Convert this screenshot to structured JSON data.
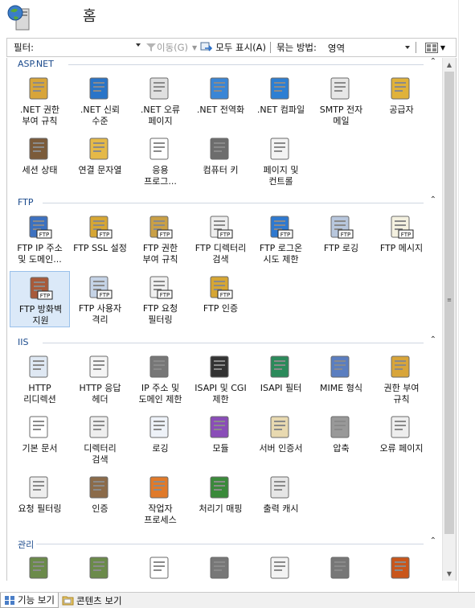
{
  "header": {
    "title": "홈"
  },
  "toolbar": {
    "filter_label": "필터:",
    "filter_value": "",
    "go_label": "이동(G)",
    "show_all_label": "모두 표시(A)",
    "group_label": "묶는 방법:",
    "group_value": "영역"
  },
  "sections": [
    {
      "title": "ASP.NET",
      "items": [
        {
          "label": ".NET 권한\n부여 규칙",
          "icon": "net-authorization-icon"
        },
        {
          "label": ".NET 신뢰\n수준",
          "icon": "net-trust-icon"
        },
        {
          "label": ".NET 오류\n페이지",
          "icon": "net-error-pages-icon"
        },
        {
          "label": ".NET 전역화",
          "icon": "net-globalization-icon"
        },
        {
          "label": ".NET 컴파일",
          "icon": "net-compilation-icon"
        },
        {
          "label": "SMTP 전자\n메일",
          "icon": "smtp-email-icon"
        },
        {
          "label": "공급자",
          "icon": "providers-icon"
        },
        {
          "label": "세션 상태",
          "icon": "session-state-icon"
        },
        {
          "label": "연결 문자열",
          "icon": "connection-strings-icon"
        },
        {
          "label": "응용\n프로그...",
          "icon": "app-settings-icon"
        },
        {
          "label": "컴퓨터 키",
          "icon": "machine-key-icon"
        },
        {
          "label": "페이지 및\n컨트롤",
          "icon": "pages-controls-icon"
        }
      ]
    },
    {
      "title": "FTP",
      "items": [
        {
          "label": "FTP IP 주소\n및 도메인...",
          "icon": "ftp-ip-domain-icon"
        },
        {
          "label": "FTP SSL 설정",
          "icon": "ftp-ssl-icon"
        },
        {
          "label": "FTP 권한\n부여 규칙",
          "icon": "ftp-authorization-icon"
        },
        {
          "label": "FTP 디렉터리\n검색",
          "icon": "ftp-directory-browsing-icon"
        },
        {
          "label": "FTP 로그온\n시도 제한",
          "icon": "ftp-logon-attempts-icon"
        },
        {
          "label": "FTP 로깅",
          "icon": "ftp-logging-icon"
        },
        {
          "label": "FTP 메시지",
          "icon": "ftp-messages-icon"
        },
        {
          "label": "FTP 방화벽\n지원",
          "icon": "ftp-firewall-icon"
        },
        {
          "label": "FTP 사용자\n격리",
          "icon": "ftp-user-isolation-icon"
        },
        {
          "label": "FTP 요청\n필터링",
          "icon": "ftp-request-filtering-icon"
        },
        {
          "label": "FTP 인증",
          "icon": "ftp-authentication-icon"
        }
      ]
    },
    {
      "title": "IIS",
      "items": [
        {
          "label": "HTTP\n리디렉션",
          "icon": "http-redirect-icon"
        },
        {
          "label": "HTTP 응답\n헤더",
          "icon": "http-response-headers-icon"
        },
        {
          "label": "IP 주소 및\n도메인 제한",
          "icon": "ip-domain-restrictions-icon"
        },
        {
          "label": "ISAPI 및 CGI\n제한",
          "icon": "isapi-cgi-icon"
        },
        {
          "label": "ISAPI 필터",
          "icon": "isapi-filters-icon"
        },
        {
          "label": "MIME 형식",
          "icon": "mime-types-icon"
        },
        {
          "label": "권한 부여\n규칙",
          "icon": "authorization-rules-icon"
        },
        {
          "label": "기본 문서",
          "icon": "default-document-icon"
        },
        {
          "label": "디렉터리\n검색",
          "icon": "directory-browsing-icon"
        },
        {
          "label": "로깅",
          "icon": "logging-icon"
        },
        {
          "label": "모듈",
          "icon": "modules-icon"
        },
        {
          "label": "서버 인증서",
          "icon": "server-certificates-icon"
        },
        {
          "label": "압축",
          "icon": "compression-icon"
        },
        {
          "label": "오류 페이지",
          "icon": "error-pages-icon"
        },
        {
          "label": "요청 필터링",
          "icon": "request-filtering-icon"
        },
        {
          "label": "인증",
          "icon": "authentication-icon"
        },
        {
          "label": "작업자\n프로세스",
          "icon": "worker-processes-icon"
        },
        {
          "label": "처리기 매핑",
          "icon": "handler-mappings-icon"
        },
        {
          "label": "출력 캐시",
          "icon": "output-caching-icon"
        }
      ]
    },
    {
      "title": "관리",
      "items": [
        {
          "label": "",
          "icon": "iis-manager-permissions-icon"
        },
        {
          "label": "",
          "icon": "iis-manager-users-icon"
        },
        {
          "label": "",
          "icon": "management-service-icon"
        },
        {
          "label": "",
          "icon": "shared-configuration-icon"
        },
        {
          "label": "",
          "icon": "configuration-editor-icon"
        },
        {
          "label": "",
          "icon": "feature-delegation-icon"
        },
        {
          "label": "",
          "icon": "web-platform-installer-icon"
        }
      ]
    }
  ],
  "tabs": [
    {
      "label": "기능 보기",
      "icon": "features-view-icon",
      "active": true
    },
    {
      "label": "콘텐츠 보기",
      "icon": "content-view-icon",
      "active": false
    }
  ]
}
